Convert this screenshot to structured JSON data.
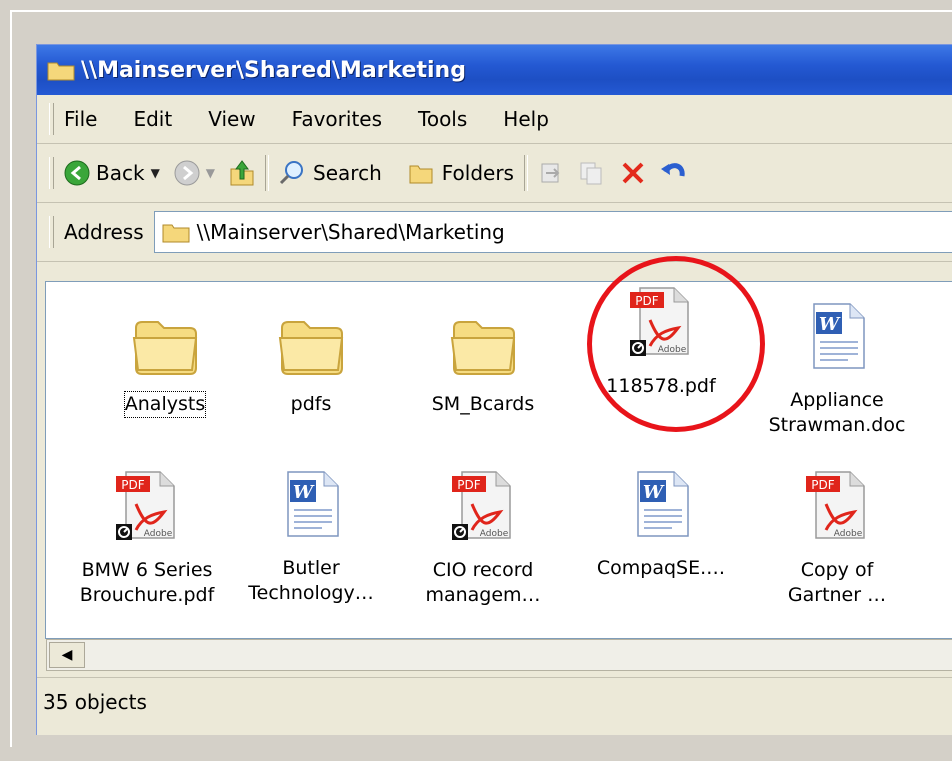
{
  "window": {
    "title": "\\\\Mainserver\\Shared\\Marketing"
  },
  "menubar": {
    "items": [
      {
        "label": "File"
      },
      {
        "label": "Edit"
      },
      {
        "label": "View"
      },
      {
        "label": "Favorites"
      },
      {
        "label": "Tools"
      },
      {
        "label": "Help"
      }
    ]
  },
  "toolbar": {
    "back_label": "Back",
    "search_label": "Search",
    "folders_label": "Folders"
  },
  "address": {
    "label": "Address",
    "value": "\\\\Mainserver\\Shared\\Marketing"
  },
  "files": [
    {
      "line1": "Analysts",
      "line2": "",
      "icon": "folder-icon"
    },
    {
      "line1": "pdfs",
      "line2": "",
      "icon": "folder-icon"
    },
    {
      "line1": "SM_Bcards",
      "line2": "",
      "icon": "folder-icon"
    },
    {
      "line1": "118578.pdf",
      "line2": "",
      "icon": "pdf-icon"
    },
    {
      "line1": "Appliance",
      "line2": "Strawman.doc",
      "icon": "word-icon"
    },
    {
      "line1": "BMW 6 Series",
      "line2": "Brouchure.pdf",
      "icon": "pdf-icon"
    },
    {
      "line1": "Butler",
      "line2": "Technology…",
      "icon": "word-icon"
    },
    {
      "line1": "CIO record",
      "line2": "managem…",
      "icon": "pdf-icon"
    },
    {
      "line1": "CompaqSE.…",
      "line2": "",
      "icon": "word-icon"
    },
    {
      "line1": "Copy of",
      "line2": "Gartner …",
      "icon": "pdf-icon"
    }
  ],
  "icon_badges": {
    "pdf_tag": "PDF",
    "adobe_tag": "Adobe",
    "word_tag": "W"
  },
  "status": {
    "text": "35 objects"
  },
  "colors": {
    "titlebar": "#2459d3",
    "annotation": "#e8141a",
    "folder": "#f5d77b"
  }
}
